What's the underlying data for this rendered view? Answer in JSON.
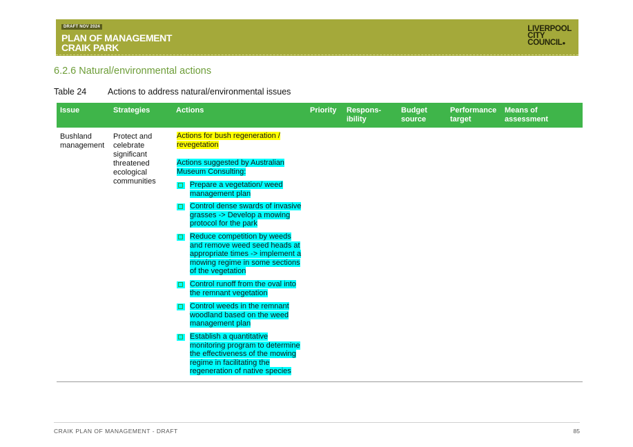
{
  "header": {
    "draft_badge": "DRAFT NOV 2024",
    "title_line1": "PLAN OF MANAGEMENT",
    "title_line2": "CRAIK PARK",
    "logo_line1": "LIVERPOOL",
    "logo_line2": "CITY",
    "logo_line3": "COUNCIL",
    "banner_color": "#a4a93a"
  },
  "section_title": "6.2.6 Natural/environmental actions",
  "table": {
    "caption_number": "Table 24",
    "caption_text": "Actions to address natural/environmental issues",
    "header_color": "#3fb54a",
    "columns": [
      "Issue",
      "Strategies",
      "Actions",
      "Priority",
      "Respons-\nibility",
      "Budget\nsource",
      "Performance\ntarget",
      "Means of\nassessment"
    ],
    "row": {
      "issue": "Bushland\nmanagement",
      "strategies": "Protect and\ncelebrate\nsignificant\nthreatened\necological\ncommunities",
      "actions_heading": "Actions for bush regeneration /\nrevegetation",
      "actions_subheading": "Actions suggested by Australian\nMuseum Consulting:",
      "actions_list": [
        "Prepare a vegetation/ weed\nmanagement plan",
        "Control dense swards of invasive\ngrasses -> Develop a mowing\nprotocol for the park",
        "Reduce competition by weeds\nand remove weed seed heads at\nappropriate times -> implement a\nmowing regime in some sections\nof the vegetation",
        "Control runoff from the oval into\nthe remnant vegetation",
        "Control weeds in the remnant\nwoodland based on the weed\nmanagement plan",
        "Establish a quantitative\nmonitoring program to determine\nthe effectiveness of the mowing\nregime in facilitating the\nregeneration of native species"
      ]
    }
  },
  "footer": {
    "left": "CRAIK PLAN OF MANAGEMENT - DRAFT",
    "page_number": "85"
  }
}
